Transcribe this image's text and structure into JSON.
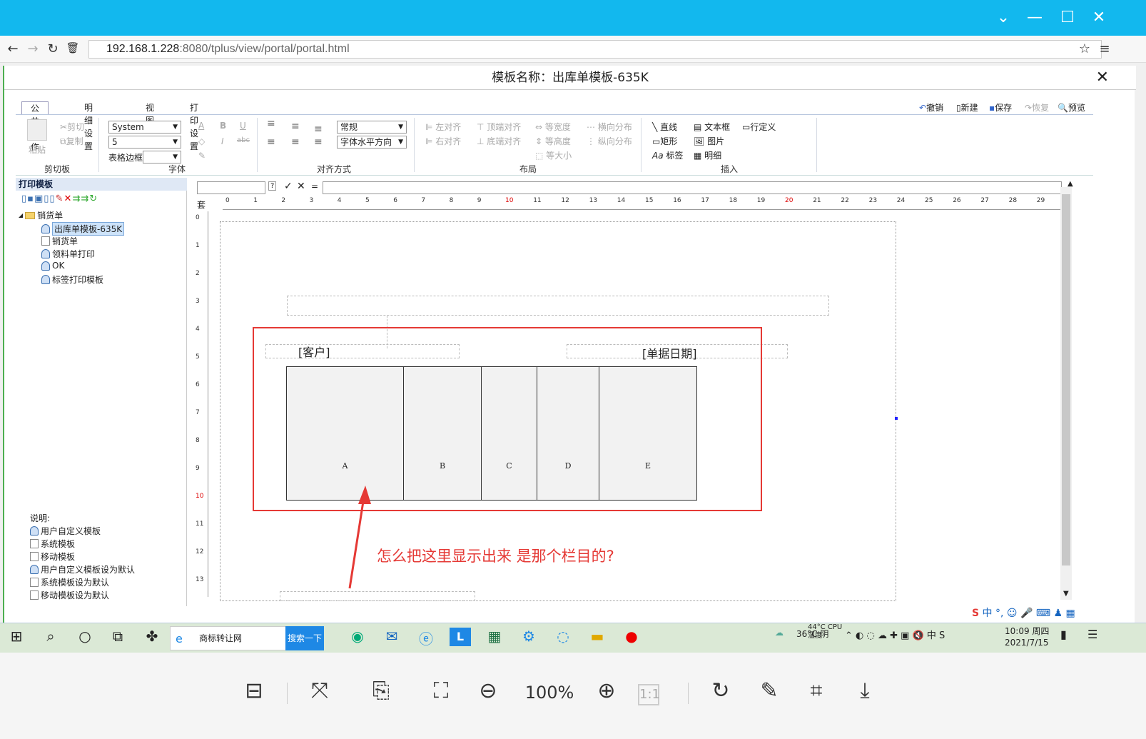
{
  "browser": {
    "url_host": "192.168.1.228",
    "url_rest": ":8080/tplus/view/portal/portal.html"
  },
  "dialog": {
    "title": "模板名称：出库单模板-635K",
    "close": "✕"
  },
  "tabs": [
    "公共操作",
    "明细设置",
    "视图",
    "打印设置"
  ],
  "quick": {
    "undo": "撤销",
    "new": "新建",
    "save": "保存",
    "redo": "恢复",
    "preview": "预览"
  },
  "ribbon": {
    "clipboard": {
      "paste": "粘贴",
      "cut": "剪切",
      "copy": "复制",
      "group": "剪切板"
    },
    "font": {
      "family": "System",
      "size": "5",
      "border_label": "表格边框",
      "group": "字体",
      "bold": "B",
      "italic": "I",
      "underline": "U",
      "strike": "abc",
      "color": "A"
    },
    "align": {
      "style": "常规",
      "halign": "字体水平方向",
      "group": "对齐方式"
    },
    "layout": {
      "left": "左对齐",
      "right": "右对齐",
      "top": "顶端对齐",
      "bottom": "底端对齐",
      "same_width": "等宽度",
      "same_height": "等高度",
      "same_size": "等大小",
      "hdist": "横向分布",
      "vdist": "纵向分布",
      "group": "布局"
    },
    "insert": {
      "line": "直线",
      "rect": "矩形",
      "label": "标签",
      "textbox": "文本框",
      "image": "图片",
      "detail": "明细",
      "rowdef": "行定义",
      "group": "插入"
    }
  },
  "left_panel": {
    "title": "打印模板",
    "tree_root": "销货单",
    "items": [
      "出库单模板-635K",
      "销货单",
      "领料单打印",
      "OK",
      "标签打印模板"
    ],
    "legend_title": "说明:",
    "legend": [
      "用户自定义模板",
      "系统模板",
      "移动模板",
      "用户自定义模板设为默认",
      "系统模板设为默认",
      "移动模板设为默认"
    ]
  },
  "formula": {
    "eq": "="
  },
  "ruler_top": [
    "0",
    "1",
    "2",
    "3",
    "4",
    "5",
    "6",
    "7",
    "8",
    "9",
    "10",
    "11",
    "12",
    "13",
    "14",
    "15",
    "16",
    "17",
    "18",
    "19",
    "20",
    "21",
    "22",
    "23",
    "24",
    "25",
    "26",
    "27",
    "28",
    "29"
  ],
  "ruler_left": [
    "0",
    "1",
    "2",
    "3",
    "4",
    "5",
    "6",
    "7",
    "8",
    "9",
    "10",
    "11",
    "12",
    "13"
  ],
  "ruler_corner": "套",
  "canvas": {
    "customer": "[客户]",
    "date": "[单据日期]",
    "columns": [
      "A",
      "B",
      "C",
      "D",
      "E"
    ]
  },
  "annotation": "怎么把这里显示出来 是那个栏目的?",
  "annotation_color": "#e53935",
  "taskbar": {
    "search_text": "商标转让网",
    "search_button": "搜索一下",
    "weather": "36°C 阴",
    "cpu": "44°C CPU温度",
    "time": "10:09 周四",
    "date": "2021/7/15",
    "ime": "中"
  },
  "viewer": {
    "zoom": "100%",
    "one_to_one": "1:1"
  }
}
